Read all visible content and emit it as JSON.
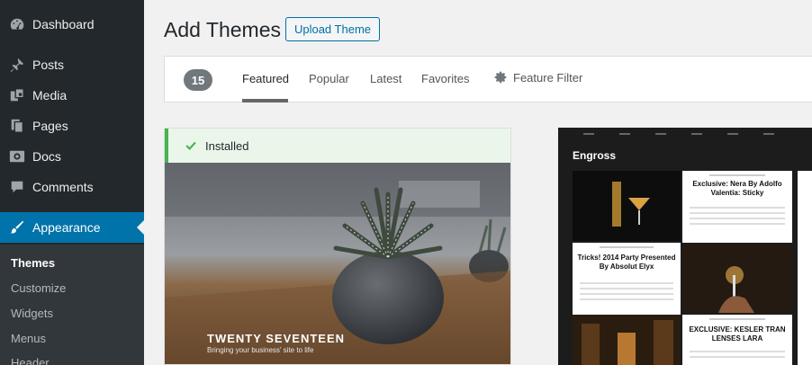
{
  "sidebar": {
    "items": [
      {
        "label": "Dashboard",
        "icon": "dashboard-icon"
      },
      {
        "label": "Posts",
        "icon": "pushpin-icon"
      },
      {
        "label": "Media",
        "icon": "media-icon"
      },
      {
        "label": "Pages",
        "icon": "pages-icon"
      },
      {
        "label": "Docs",
        "icon": "docs-icon"
      },
      {
        "label": "Comments",
        "icon": "comment-icon"
      },
      {
        "label": "Appearance",
        "icon": "paintbrush-icon"
      }
    ],
    "submenu": [
      "Themes",
      "Customize",
      "Widgets",
      "Menus",
      "Header"
    ]
  },
  "header": {
    "title": "Add Themes",
    "upload_label": "Upload Theme"
  },
  "filter_bar": {
    "count": "15",
    "tabs": [
      "Featured",
      "Popular",
      "Latest",
      "Favorites"
    ],
    "feature_filter": "Feature Filter"
  },
  "theme1": {
    "status": "Installed",
    "name": "TWENTY SEVENTEEN",
    "tagline": "Bringing your business' site to life"
  },
  "theme2": {
    "site_title": "Engross",
    "posts": [
      "Exclusive: Nera By Adolfo Valentia: Sticky",
      "Tricks! 2014 Party Presented By Absolut Elyx",
      "EXCLUSIVE: KESLER TRAN LENSES LARA"
    ]
  },
  "colors": {
    "sidebar_bg": "#23282d",
    "accent": "#0073aa",
    "installed_green": "#46b450"
  }
}
